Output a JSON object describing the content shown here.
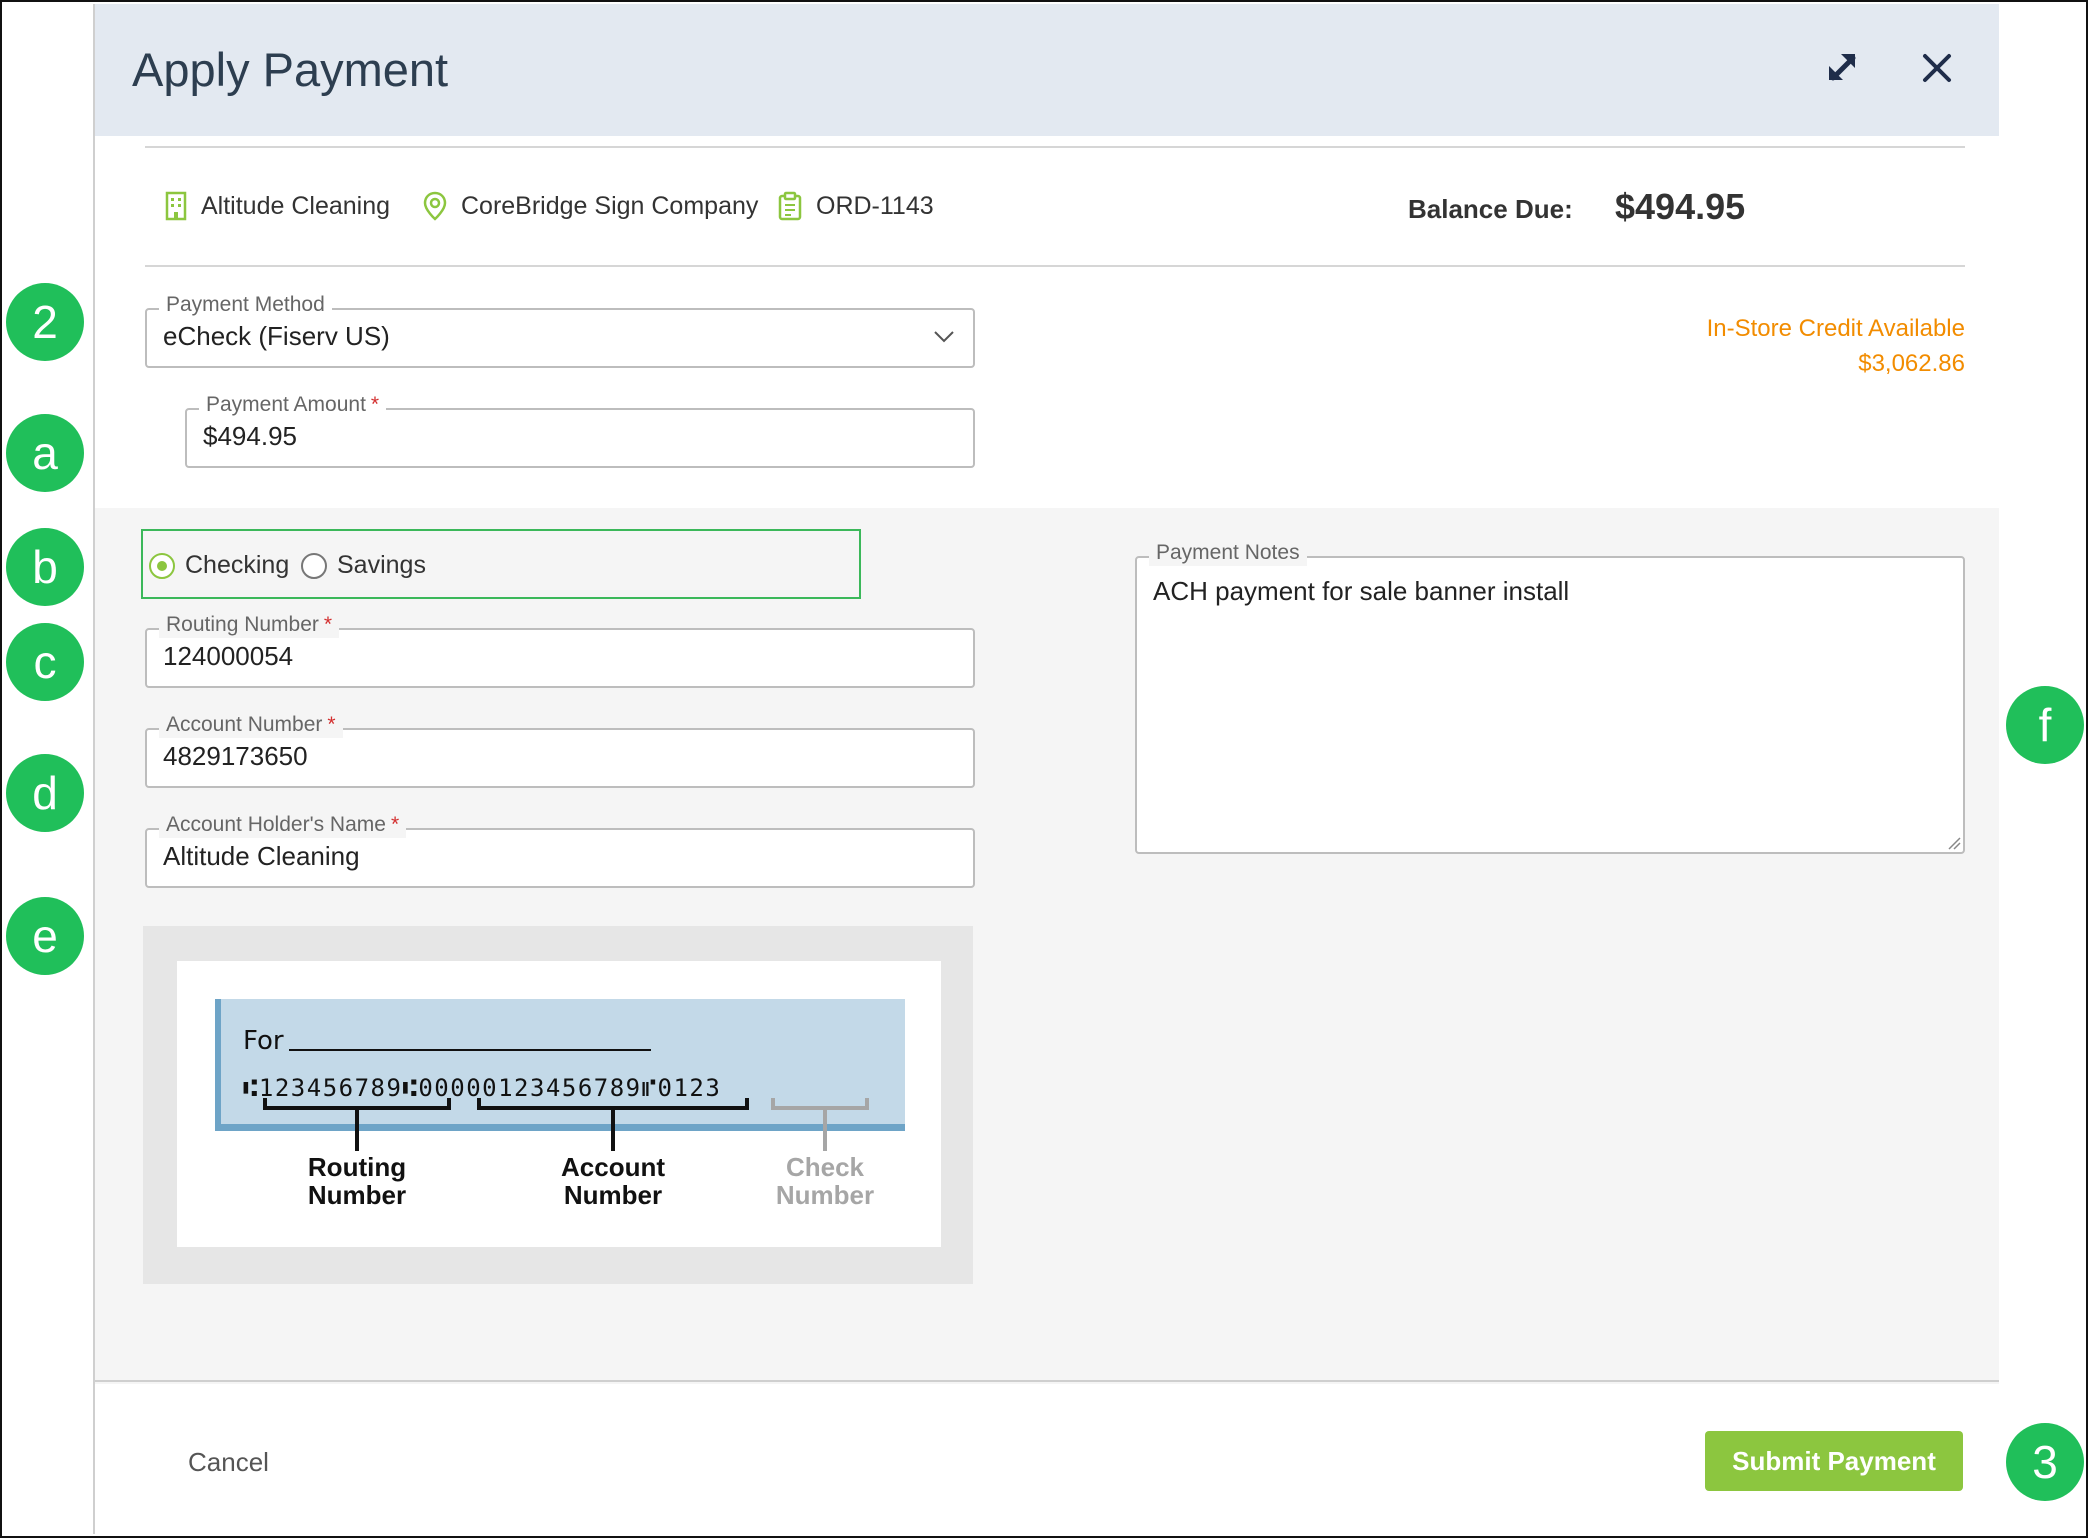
{
  "modal": {
    "title": "Apply Payment"
  },
  "info_bar": {
    "customer": "Altitude Cleaning",
    "location": "CoreBridge Sign Company",
    "order": "ORD-1143",
    "balance_label": "Balance Due:",
    "balance_value": "$494.95"
  },
  "credit": {
    "label": "In-Store Credit Available",
    "amount": "$3,062.86"
  },
  "form": {
    "payment_method": {
      "label": "Payment Method",
      "value": "eCheck (Fiserv US)"
    },
    "payment_amount": {
      "label": "Payment Amount",
      "value": "$494.95"
    },
    "account_type": {
      "options": [
        "Checking",
        "Savings"
      ],
      "selected": "Checking"
    },
    "routing_number": {
      "label": "Routing Number",
      "value": "124000054"
    },
    "account_number": {
      "label": "Account Number",
      "value": "4829173650"
    },
    "holder_name": {
      "label": "Account Holder's Name",
      "value": "Altitude Cleaning"
    },
    "payment_notes": {
      "label": "Payment Notes",
      "value": "ACH payment for sale banner install"
    },
    "required_mark": "*"
  },
  "check_diagram": {
    "for_label": "For",
    "micr_line": "⑆123456789⑆00000123456789⑈0123",
    "routing_label": [
      "Routing",
      "Number"
    ],
    "account_label": [
      "Account",
      "Number"
    ],
    "check_label": [
      "Check",
      "Number"
    ]
  },
  "footer": {
    "cancel_label": "Cancel",
    "submit_label": "Submit Payment"
  },
  "callouts": [
    "2",
    "a",
    "b",
    "c",
    "d",
    "e",
    "f",
    "3"
  ],
  "colors": {
    "accent_green": "#8cc63f",
    "callout_green": "#20bf5a",
    "credit_orange": "#f28c00",
    "header_bg": "#e3e9f1"
  }
}
